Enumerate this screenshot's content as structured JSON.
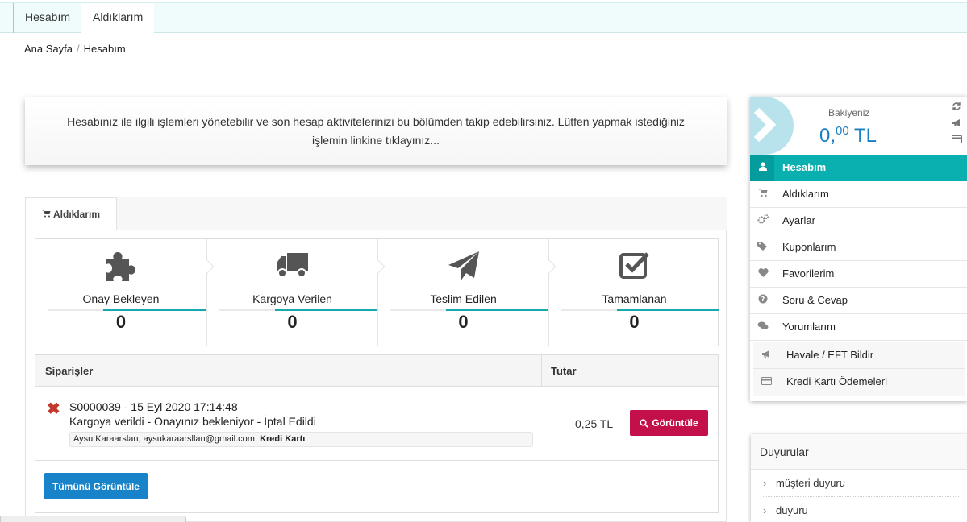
{
  "top_tabs": [
    "Hesabım",
    "Aldıklarım"
  ],
  "breadcrumb": {
    "home": "Ana Sayfa",
    "sep": "/",
    "current": "Hesabım"
  },
  "info_text": "Hesabınız ile ilgili işlemleri yönetebilir ve son hesap aktivitelerinizi bu bölümden takip edebilirsiniz. Lütfen yapmak istediğiniz işlemin linkine tıklayınız...",
  "panel_tab": {
    "icon": "cart-icon",
    "label": "Aldıklarım"
  },
  "stats": [
    {
      "icon": "puzzle-icon",
      "label": "Onay Bekleyen",
      "value": "0"
    },
    {
      "icon": "truck-icon",
      "label": "Kargoya Verilen",
      "value": "0"
    },
    {
      "icon": "paper-plane-icon",
      "label": "Teslim Edilen",
      "value": "0"
    },
    {
      "icon": "check-square-icon",
      "label": "Tamamlanan",
      "value": "0"
    }
  ],
  "orders": {
    "headers": {
      "orders": "Siparişler",
      "amount": "Tutar"
    },
    "rows": [
      {
        "status_icon": "cancel-x-icon",
        "title": "S0000039 - 15 Eyl 2020 17:14:48",
        "status": "Kargoya verildi - Onayınız bekleniyor - İptal Edildi",
        "customer": "Aysu Karaarslan, aysukaraarsllan@gmail.com,",
        "payment": "Kredi Kartı",
        "amount": "0,25 TL",
        "view_label": "Görüntüle"
      }
    ],
    "view_all_label": "Tümünü Görüntüle"
  },
  "balance": {
    "label": "Bakiyeniz",
    "whole": "0,",
    "fraction": "00",
    "currency": "TL"
  },
  "menu": [
    {
      "icon": "user-icon",
      "label": "Hesabım",
      "active": true
    },
    {
      "icon": "cart-icon",
      "label": "Aldıklarım"
    },
    {
      "icon": "gears-icon",
      "label": "Ayarlar"
    },
    {
      "icon": "tags-icon",
      "label": "Kuponlarım"
    },
    {
      "icon": "heart-icon",
      "label": "Favorilerim"
    },
    {
      "icon": "question-icon",
      "label": "Soru & Cevap"
    },
    {
      "icon": "comments-icon",
      "label": "Yorumlarım"
    }
  ],
  "menu2": [
    {
      "icon": "bullhorn-icon",
      "label": "Havale / EFT Bildir"
    },
    {
      "icon": "credit-card-icon",
      "label": "Kredi Kartı Ödemeleri"
    }
  ],
  "announcements": {
    "title": "Duyurular",
    "items": [
      "müşteri duyuru",
      "duyuru"
    ]
  },
  "colors": {
    "teal": "#0aafaf",
    "brand_red": "#c4104a",
    "blue": "#1883c8",
    "balance_blue": "#1a7fc1"
  }
}
